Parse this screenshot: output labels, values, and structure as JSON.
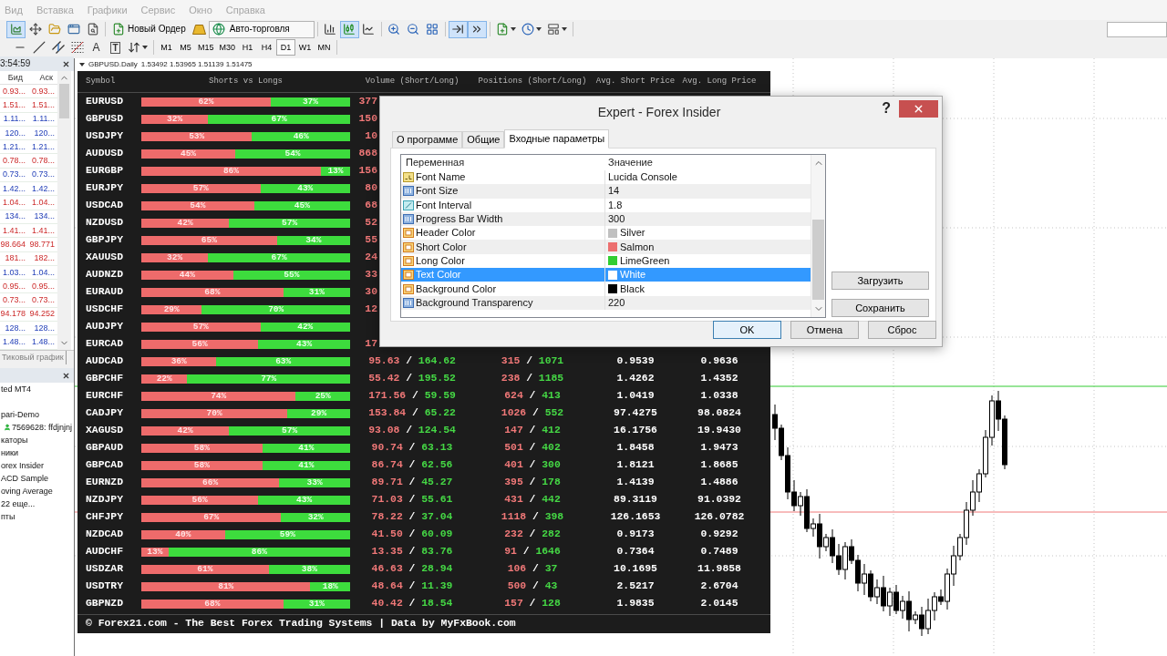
{
  "menu": [
    {
      "label": "Вид",
      "disabled": true
    },
    {
      "label": "Вставка",
      "disabled": true
    },
    {
      "label": "Графики",
      "disabled": true
    },
    {
      "label": "Сервис",
      "disabled": true
    },
    {
      "label": "Окно",
      "disabled": true
    },
    {
      "label": "Справка",
      "disabled": true
    }
  ],
  "toolbar_main": [
    [
      {
        "kind": "chart",
        "on": true
      },
      {
        "kind": "move",
        "on": false
      },
      {
        "kind": "folder",
        "on": false
      },
      {
        "kind": "window",
        "on": false
      },
      {
        "kind": "file-search",
        "on": false
      }
    ],
    [
      {
        "kind": "new-order",
        "label": "Новый Ордер",
        "on": false
      },
      {
        "kind": "gold",
        "on": false
      },
      {
        "kind": "auto-trading",
        "label": "Авто-торговля",
        "on": false
      }
    ],
    [
      {
        "kind": "bars",
        "on": false
      },
      {
        "kind": "candles",
        "on": true
      },
      {
        "kind": "line",
        "on": false
      }
    ],
    [
      {
        "kind": "zoom-in",
        "on": false
      },
      {
        "kind": "zoom-out",
        "on": false
      },
      {
        "kind": "tile",
        "on": false
      }
    ],
    [
      {
        "kind": "shift",
        "on": true
      },
      {
        "kind": "autoscroll",
        "on": true
      }
    ],
    [
      {
        "kind": "add",
        "on": false
      },
      {
        "kind": "clock",
        "on": false
      },
      {
        "kind": "template",
        "on": false
      }
    ]
  ],
  "toolbar_draw": [
    {
      "kind": "hline",
      "on": false
    },
    {
      "kind": "trendline",
      "on": false
    },
    {
      "kind": "channel",
      "on": false
    },
    {
      "kind": "fibo",
      "on": false
    },
    {
      "kind": "text",
      "glyph": "A",
      "on": false
    },
    {
      "kind": "label",
      "glyph": "T",
      "on": false
    },
    {
      "kind": "arrows",
      "on": false
    }
  ],
  "toolbar_periods": [
    {
      "label": "M1",
      "selected": false
    },
    {
      "label": "M5",
      "selected": false
    },
    {
      "label": "M15",
      "selected": false
    },
    {
      "label": "M30",
      "selected": false
    },
    {
      "label": "H1",
      "selected": false
    },
    {
      "label": "H4",
      "selected": false
    },
    {
      "label": "D1",
      "selected": true
    },
    {
      "label": "W1",
      "selected": false
    },
    {
      "label": "MN",
      "selected": false
    }
  ],
  "market_watch": {
    "time": "3:54:59",
    "columns": [
      "Бид",
      "Аск"
    ],
    "rows": [
      {
        "bid": "0.93...",
        "ask": "0.93...",
        "falling": true
      },
      {
        "bid": "1.51...",
        "ask": "1.51...",
        "falling": true
      },
      {
        "bid": "1.11...",
        "ask": "1.11...",
        "falling": false
      },
      {
        "bid": "120...",
        "ask": "120...",
        "falling": false
      },
      {
        "bid": "1.21...",
        "ask": "1.21...",
        "falling": false
      },
      {
        "bid": "0.78...",
        "ask": "0.78...",
        "falling": true
      },
      {
        "bid": "0.73...",
        "ask": "0.73...",
        "falling": false
      },
      {
        "bid": "1.42...",
        "ask": "1.42...",
        "falling": false
      },
      {
        "bid": "1.04...",
        "ask": "1.04...",
        "falling": true
      },
      {
        "bid": "134...",
        "ask": "134...",
        "falling": false
      },
      {
        "bid": "1.41...",
        "ask": "1.41...",
        "falling": true
      },
      {
        "bid": "98.664",
        "ask": "98.771",
        "falling": true
      },
      {
        "bid": "181...",
        "ask": "182...",
        "falling": true
      },
      {
        "bid": "1.03...",
        "ask": "1.04...",
        "falling": false
      },
      {
        "bid": "0.95...",
        "ask": "0.95...",
        "falling": true
      },
      {
        "bid": "0.73...",
        "ask": "0.73...",
        "falling": true
      },
      {
        "bid": "94.178",
        "ask": "94.252",
        "falling": true
      },
      {
        "bid": "128...",
        "ask": "128...",
        "falling": false
      },
      {
        "bid": "1.48...",
        "ask": "1.48...",
        "falling": false
      }
    ],
    "tabs": [
      {
        "label": "Тиковый график",
        "selected": false
      }
    ]
  },
  "navigator": {
    "items": [
      {
        "label": "ted MT4"
      },
      {
        "label": "pari-Demo",
        "children": [
          {
            "label": "7569628: ffdjnjnj"
          }
        ]
      },
      {
        "label": "каторы"
      },
      {
        "label": "ники"
      },
      {
        "label": "orex Insider"
      },
      {
        "label": "ACD Sample"
      },
      {
        "label": "oving Average"
      },
      {
        "label": "22 еще..."
      },
      {
        "label": "пты"
      }
    ]
  },
  "chart": {
    "symbol": "GBPUSD.Daily",
    "prices": "1.53492 1.53965 1.51139 1.51475"
  },
  "insider": {
    "columns": [
      "Symbol",
      "Shorts vs Longs",
      "Volume (Short/Long)",
      "Positions (Short/Long)",
      "Avg. Short Price",
      "Avg. Long Price"
    ],
    "rows": [
      {
        "symbol": "EURUSD",
        "short": "62%",
        "long": "37%",
        "level": 0.62,
        "volume": {
          "short": "377"
        }
      },
      {
        "symbol": "GBPUSD",
        "short": "32%",
        "long": "67%",
        "level": 0.32,
        "volume": {
          "short": "150"
        }
      },
      {
        "symbol": "USDJPY",
        "short": "53%",
        "long": "46%",
        "level": 0.53,
        "volume": {
          "short": "10"
        }
      },
      {
        "symbol": "AUDUSD",
        "short": "45%",
        "long": "54%",
        "level": 0.45,
        "volume": {
          "short": "868"
        }
      },
      {
        "symbol": "EURGBP",
        "short": "86%",
        "long": "13%",
        "level": 0.86,
        "volume": {
          "short": "156"
        }
      },
      {
        "symbol": "EURJPY",
        "short": "57%",
        "long": "43%",
        "level": 0.57,
        "volume": {
          "short": "80"
        }
      },
      {
        "symbol": "USDCAD",
        "short": "54%",
        "long": "45%",
        "level": 0.54,
        "volume": {
          "short": "68"
        }
      },
      {
        "symbol": "NZDUSD",
        "short": "42%",
        "long": "57%",
        "level": 0.42,
        "volume": {
          "short": "52"
        }
      },
      {
        "symbol": "GBPJPY",
        "short": "65%",
        "long": "34%",
        "level": 0.65,
        "volume": {
          "short": "55"
        }
      },
      {
        "symbol": "XAUUSD",
        "short": "32%",
        "long": "67%",
        "level": 0.32,
        "volume": {
          "short": "24"
        }
      },
      {
        "symbol": "AUDNZD",
        "short": "44%",
        "long": "55%",
        "level": 0.44,
        "volume": {
          "short": "33"
        }
      },
      {
        "symbol": "EURAUD",
        "short": "68%",
        "long": "31%",
        "level": 0.68,
        "volume": {
          "short": "30"
        }
      },
      {
        "symbol": "USDCHF",
        "short": "29%",
        "long": "70%",
        "level": 0.29,
        "volume": {
          "short": "12"
        }
      },
      {
        "symbol": "AUDJPY",
        "short": "57%",
        "long": "42%",
        "level": 0.57
      },
      {
        "symbol": "EURCAD",
        "short": "56%",
        "long": "43%",
        "level": 0.56,
        "volume": {
          "short": "17"
        }
      },
      {
        "symbol": "AUDCAD",
        "short": "36%",
        "long": "63%",
        "level": 0.36,
        "volume": {
          "short": "95.63",
          "sep": "/",
          "long": "164.62"
        },
        "positions": {
          "short": "315",
          "sep": "/",
          "long": "1071"
        },
        "avg_short": "0.9539",
        "avg_long": "0.9636"
      },
      {
        "symbol": "GBPCHF",
        "short": "22%",
        "long": "77%",
        "level": 0.22,
        "volume": {
          "short": "55.42",
          "sep": "/",
          "long": "195.52"
        },
        "positions": {
          "short": "238",
          "sep": "/",
          "long": "1185"
        },
        "avg_short": "1.4262",
        "avg_long": "1.4352"
      },
      {
        "symbol": "EURCHF",
        "short": "74%",
        "long": "25%",
        "level": 0.74,
        "volume": {
          "short": "171.56",
          "sep": "/",
          "long": "59.59"
        },
        "positions": {
          "short": "624",
          "sep": "/",
          "long": "413"
        },
        "avg_short": "1.0419",
        "avg_long": "1.0338"
      },
      {
        "symbol": "CADJPY",
        "short": "70%",
        "long": "29%",
        "level": 0.7,
        "volume": {
          "short": "153.84",
          "sep": "/",
          "long": "65.22"
        },
        "positions": {
          "short": "1026",
          "sep": "/",
          "long": "552"
        },
        "avg_short": "97.4275",
        "avg_long": "98.0824"
      },
      {
        "symbol": "XAGUSD",
        "short": "42%",
        "long": "57%",
        "level": 0.42,
        "volume": {
          "short": "93.08",
          "sep": "/",
          "long": "124.54"
        },
        "positions": {
          "short": "147",
          "sep": "/",
          "long": "412"
        },
        "avg_short": "16.1756",
        "avg_long": "19.9430"
      },
      {
        "symbol": "GBPAUD",
        "short": "58%",
        "long": "41%",
        "level": 0.58,
        "volume": {
          "short": "90.74",
          "sep": "/",
          "long": "63.13"
        },
        "positions": {
          "short": "501",
          "sep": "/",
          "long": "402"
        },
        "avg_short": "1.8458",
        "avg_long": "1.9473"
      },
      {
        "symbol": "GBPCAD",
        "short": "58%",
        "long": "41%",
        "level": 0.58,
        "volume": {
          "short": "86.74",
          "sep": "/",
          "long": "62.56"
        },
        "positions": {
          "short": "401",
          "sep": "/",
          "long": "300"
        },
        "avg_short": "1.8121",
        "avg_long": "1.8685"
      },
      {
        "symbol": "EURNZD",
        "short": "66%",
        "long": "33%",
        "level": 0.66,
        "volume": {
          "short": "89.71",
          "sep": "/",
          "long": "45.27"
        },
        "positions": {
          "short": "395",
          "sep": "/",
          "long": "178"
        },
        "avg_short": "1.4139",
        "avg_long": "1.4886"
      },
      {
        "symbol": "NZDJPY",
        "short": "56%",
        "long": "43%",
        "level": 0.56,
        "volume": {
          "short": "71.03",
          "sep": "/",
          "long": "55.61"
        },
        "positions": {
          "short": "431",
          "sep": "/",
          "long": "442"
        },
        "avg_short": "89.3119",
        "avg_long": "91.0392"
      },
      {
        "symbol": "CHFJPY",
        "short": "67%",
        "long": "32%",
        "level": 0.67,
        "volume": {
          "short": "78.22",
          "sep": "/",
          "long": "37.04"
        },
        "positions": {
          "short": "1118",
          "sep": "/",
          "long": "398"
        },
        "avg_short": "126.1653",
        "avg_long": "126.0782"
      },
      {
        "symbol": "NZDCAD",
        "short": "40%",
        "long": "59%",
        "level": 0.4,
        "volume": {
          "short": "41.50",
          "sep": "/",
          "long": "60.09"
        },
        "positions": {
          "short": "232",
          "sep": "/",
          "long": "282"
        },
        "avg_short": "0.9173",
        "avg_long": "0.9292"
      },
      {
        "symbol": "AUDCHF",
        "short": "13%",
        "long": "86%",
        "level": 0.13,
        "volume": {
          "short": "13.35",
          "sep": "/",
          "long": "83.76"
        },
        "positions": {
          "short": "91",
          "sep": "/",
          "long": "1646"
        },
        "avg_short": "0.7364",
        "avg_long": "0.7489"
      },
      {
        "symbol": "USDZAR",
        "short": "61%",
        "long": "38%",
        "level": 0.61,
        "volume": {
          "short": "46.63",
          "sep": "/",
          "long": "28.94"
        },
        "positions": {
          "short": "106",
          "sep": "/",
          "long": "37"
        },
        "avg_short": "10.1695",
        "avg_long": "11.9858"
      },
      {
        "symbol": "USDTRY",
        "short": "81%",
        "long": "18%",
        "level": 0.81,
        "volume": {
          "short": "48.64",
          "sep": "/",
          "long": "11.39"
        },
        "positions": {
          "short": "500",
          "sep": "/",
          "long": "43"
        },
        "avg_short": "2.5217",
        "avg_long": "2.6704"
      },
      {
        "symbol": "GBPNZD",
        "short": "68%",
        "long": "31%",
        "level": 0.68,
        "volume": {
          "short": "40.42",
          "sep": "/",
          "long": "18.54"
        },
        "positions": {
          "short": "157",
          "sep": "/",
          "long": "128"
        },
        "avg_short": "1.9835",
        "avg_long": "2.0145"
      }
    ],
    "footer": "© Forex21.com - The Best Forex Trading Systems | Data by MyFxBook.com"
  },
  "dialog": {
    "title": "Expert - Forex Insider",
    "help": "?",
    "tabs": [
      {
        "label": "О программе",
        "selected": false
      },
      {
        "label": "Общие",
        "selected": false
      },
      {
        "label": "Входные параметры",
        "selected": true
      }
    ],
    "columns": [
      "Переменная",
      "Значение"
    ],
    "params": [
      {
        "kind": "string",
        "name": "Font Name",
        "value": "Lucida Console",
        "selected": false
      },
      {
        "kind": "int",
        "name": "Font Size",
        "value": "14",
        "selected": false
      },
      {
        "kind": "double",
        "name": "Font Interval",
        "value": "1.8",
        "selected": false
      },
      {
        "kind": "int",
        "name": "Progress Bar Width",
        "value": "300",
        "selected": false
      },
      {
        "kind": "color",
        "name": "Header Color",
        "value": "Silver",
        "color": "#c0c0c0",
        "selected": false
      },
      {
        "kind": "color",
        "name": "Short Color",
        "value": "Salmon",
        "color": "#ec6f6f",
        "selected": false
      },
      {
        "kind": "color",
        "name": "Long Color",
        "value": "LimeGreen",
        "color": "#32cd32",
        "selected": false
      },
      {
        "kind": "color",
        "name": "Text Color",
        "value": "White",
        "color": "#ffffff",
        "selected": true
      },
      {
        "kind": "color",
        "name": "Background Color",
        "value": "Black",
        "color": "#000000",
        "selected": false
      },
      {
        "kind": "int",
        "name": "Background Transparency",
        "value": "220",
        "selected": false
      }
    ],
    "side_buttons": [
      "Загрузить",
      "Сохранить"
    ],
    "buttons": [
      {
        "label": "OK",
        "default": true
      },
      {
        "label": "Отмена",
        "default": false
      },
      {
        "label": "Сброс",
        "default": false
      }
    ]
  }
}
